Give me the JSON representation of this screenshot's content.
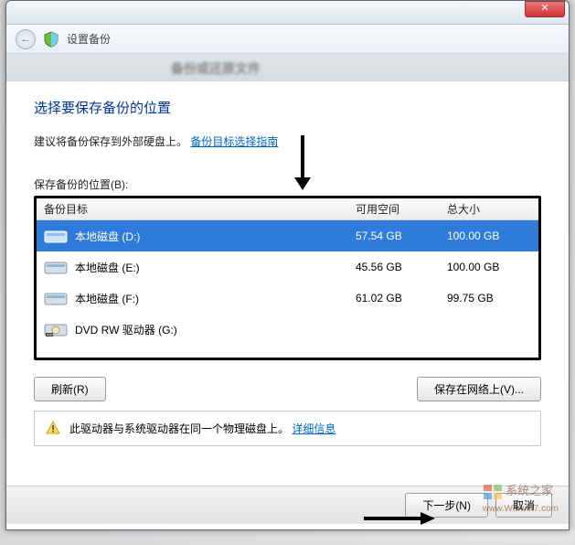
{
  "window": {
    "nav_title": "设置备份",
    "blur_title": "备份或还原文件"
  },
  "content": {
    "title": "选择要保存备份的位置",
    "subtitle_prefix": "建议将备份保存到外部硬盘上。",
    "guide_link": "备份目标选择指南",
    "list_label": "保存备份的位置(B):"
  },
  "columns": {
    "target": "备份目标",
    "free": "可用空间",
    "total": "总大小"
  },
  "drives": [
    {
      "name": "本地磁盘 (D:)",
      "free": "57.54 GB",
      "total": "100.00 GB",
      "type": "hdd",
      "selected": true
    },
    {
      "name": "本地磁盘 (E:)",
      "free": "45.56 GB",
      "total": "100.00 GB",
      "type": "hdd",
      "selected": false
    },
    {
      "name": "本地磁盘 (F:)",
      "free": "61.02 GB",
      "total": "99.75 GB",
      "type": "hdd",
      "selected": false
    },
    {
      "name": "DVD RW 驱动器 (G:)",
      "free": "",
      "total": "",
      "type": "dvd",
      "selected": false
    }
  ],
  "buttons": {
    "refresh": "刷新(R)",
    "save_network": "保存在网络上(V)...",
    "next": "下一步(N)",
    "cancel": "取消"
  },
  "warning": {
    "text": "此驱动器与系统驱动器在同一个物理磁盘上。",
    "link": "详细信息"
  },
  "watermark": {
    "text": "系统之家",
    "url": "www.Winwin7.com"
  }
}
